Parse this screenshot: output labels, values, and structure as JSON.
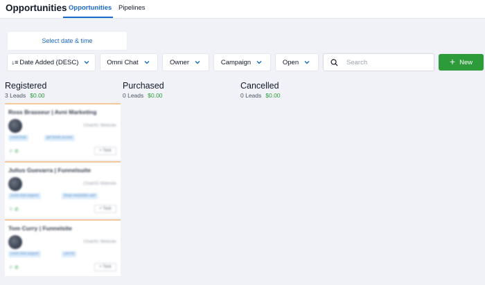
{
  "header": {
    "app_title": "Opportunities",
    "tabs": [
      {
        "label": "Opportunities",
        "active": true
      },
      {
        "label": "Pipelines",
        "active": false
      }
    ]
  },
  "toolbar": {
    "date_button_label": "Select date & time",
    "sort_label": "Date Added (DESC)",
    "filters": [
      "Omni Chat",
      "Owner",
      "Campaign",
      "Open"
    ],
    "search_placeholder": "Search",
    "new_button_label": "New"
  },
  "columns": [
    {
      "name": "Registered",
      "count_label": "3 Leads",
      "amount": "$0.00"
    },
    {
      "name": "Purchased",
      "count_label": "0 Leads",
      "amount": "$0.00"
    },
    {
      "name": "Cancelled",
      "count_label": "0 Leads",
      "amount": "$0.00"
    }
  ],
  "cards": [
    {
      "name": "Ross Brasseur | Avni Marketing",
      "source": "Chat/IG Website",
      "tags": [
        "covid lead",
        "get funds access"
      ],
      "icons": "⚐ ✆",
      "task": "+ Task"
    },
    {
      "name": "Julius Guevarra | Funnelsuite",
      "source": "Chat/IG Website",
      "tags": [
        "covid chat support",
        "Shop newsletter add"
      ],
      "icons": "⚐ ✆",
      "task": "+ Task"
    },
    {
      "name": "Tom Curry | Funnelsite",
      "source": "Chat/IG Website",
      "tags": [
        "covid chat support",
        "cart lot"
      ],
      "icons": "⚐ ✆",
      "task": "+ Task"
    }
  ],
  "colors": {
    "accent": "#1769c7",
    "success": "#2e9b3a",
    "card_border": "#f5c89c",
    "background": "#f0f2f7"
  },
  "icons": {
    "sort": "sort-descending-icon",
    "chevron": "chevron-down-icon",
    "search": "search-icon",
    "plus": "plus-icon"
  }
}
